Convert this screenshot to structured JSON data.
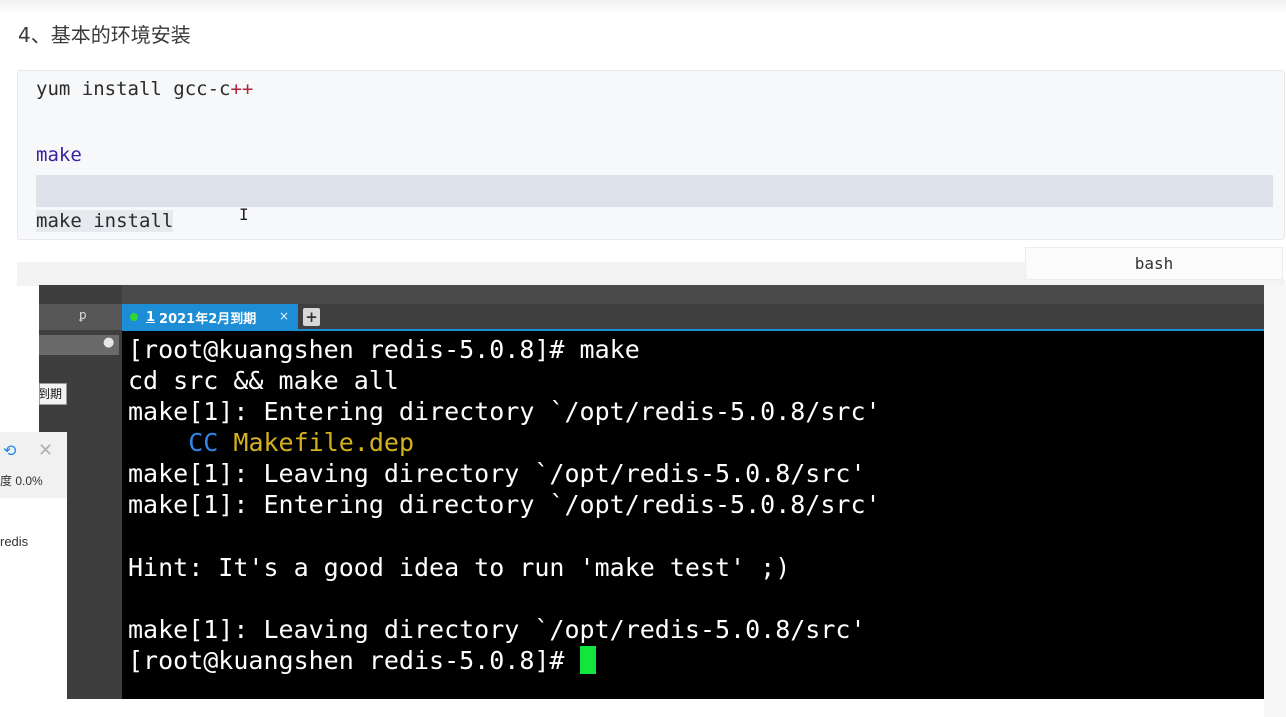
{
  "article": {
    "section_heading": "4、基本的环境安装"
  },
  "code_block": {
    "language_label": "bash",
    "lines": [
      {
        "cmd": "yum install gcc-c",
        "suffix": "++"
      },
      {
        "cmd": "make"
      },
      {
        "cmd": "make install"
      }
    ],
    "cursor_glyph": "I"
  },
  "terminal_app": {
    "pin_icon": "pin-icon",
    "search_icon": "search-icon",
    "left_pane_label": "到期",
    "tab": {
      "number": "1",
      "title": "2021年2月到期",
      "close": "×",
      "status_color": "#2fd82f"
    },
    "add_tab": "+",
    "lines": [
      "[root@kuangshen redis-5.0.8]# make",
      "cd src && make all",
      "make[1]: Entering directory `/opt/redis-5.0.8/src'",
      {
        "indent": "    ",
        "tag": "CC",
        "file": "Makefile.dep"
      },
      "make[1]: Leaving directory `/opt/redis-5.0.8/src'",
      "make[1]: Entering directory `/opt/redis-5.0.8/src'",
      "",
      "Hint: It's a good idea to run 'make test' ;)",
      "",
      "make[1]: Leaving directory `/opt/redis-5.0.8/src'",
      "[root@kuangshen redis-5.0.8]# "
    ],
    "colors": {
      "cc": "#2d86e8",
      "makefile": "#d4b21e",
      "cursor": "#12e63a"
    }
  },
  "side_widget": {
    "share_icon": "share-icon",
    "close_icon": "close-icon",
    "progress_text": "度 0.0%",
    "item_text": "redis"
  }
}
